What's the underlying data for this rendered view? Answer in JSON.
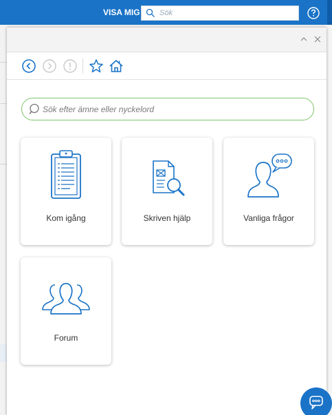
{
  "topbar": {
    "visa_mig": "VISA MIG",
    "search_placeholder": "Sök",
    "accent": "#1a73c7"
  },
  "panel": {
    "search_placeholder": "Sök efter ämne eller nyckelord",
    "search_border": "#7fc36a",
    "icon_color": "#1a73c7",
    "nav_icons": [
      "back-icon",
      "forward-icon",
      "alert-icon",
      "star-icon",
      "home-icon"
    ],
    "header_icons": [
      "chevron-up-icon",
      "close-icon"
    ],
    "cards": [
      {
        "label": "Kom igång",
        "icon": "clipboard-icon"
      },
      {
        "label": "Skriven hjälp",
        "icon": "document-search-icon"
      },
      {
        "label": "Vanliga frågor",
        "icon": "person-speech-icon"
      },
      {
        "label": "Forum",
        "icon": "people-group-icon"
      }
    ]
  },
  "chat": {
    "icon": "chat-bubble-icon"
  }
}
